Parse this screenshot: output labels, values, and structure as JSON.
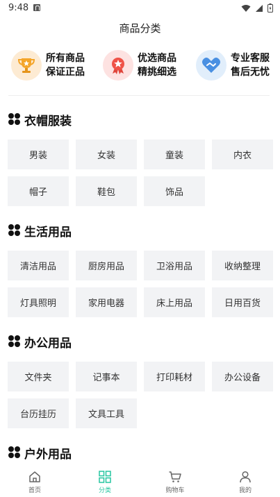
{
  "status": {
    "time": "9:48"
  },
  "header": {
    "title": "商品分类"
  },
  "features": [
    {
      "icon": "trophy-icon",
      "line1": "所有商品",
      "line2": "保证正品"
    },
    {
      "icon": "star-badge-icon",
      "line1": "优选商品",
      "line2": "精挑细选"
    },
    {
      "icon": "handshake-icon",
      "line1": "专业客服",
      "line2": "售后无忧"
    }
  ],
  "sections": [
    {
      "title": "衣帽服装",
      "items": [
        "男装",
        "女装",
        "童装",
        "内衣",
        "帽子",
        "鞋包",
        "饰品"
      ]
    },
    {
      "title": "生活用品",
      "items": [
        "清洁用品",
        "厨房用品",
        "卫浴用品",
        "收纳整理",
        "灯具照明",
        "家用电器",
        "床上用品",
        "日用百货"
      ]
    },
    {
      "title": "办公用品",
      "items": [
        "文件夹",
        "记事本",
        "打印耗材",
        "办公设备",
        "台历挂历",
        "文具工具"
      ]
    },
    {
      "title": "户外用品",
      "items": []
    }
  ],
  "tabbar": {
    "tabs": [
      {
        "label": "首页",
        "icon": "home-icon"
      },
      {
        "label": "分类",
        "icon": "grid-icon"
      },
      {
        "label": "购物车",
        "icon": "cart-icon"
      },
      {
        "label": "我的",
        "icon": "person-icon"
      }
    ],
    "active_color": "#26c6a0"
  }
}
